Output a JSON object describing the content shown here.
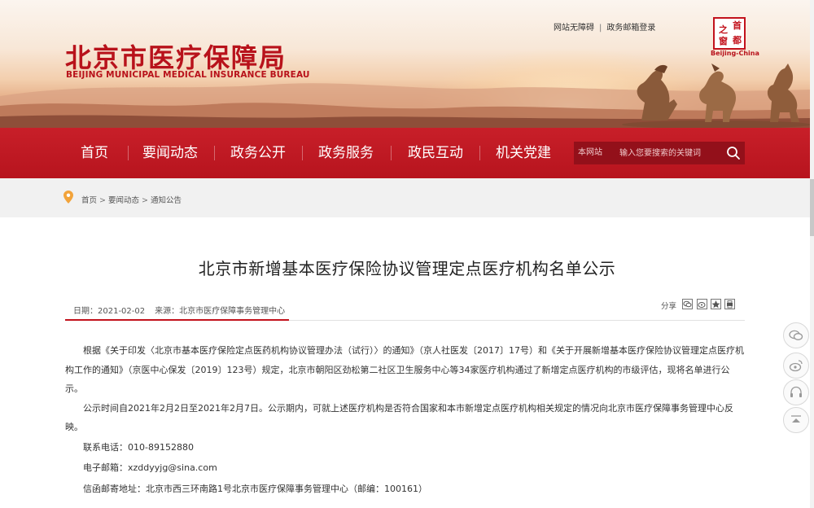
{
  "header": {
    "title_cn": "北京市医疗保障局",
    "title_en": "BEIJING MUNICIPAL MEDICAL INSURANCE BUREAU",
    "top_links": [
      "网站无障碍",
      "政务邮箱登录"
    ],
    "top_links_separator": "|",
    "seal_chars": [
      "首",
      "都",
      "之",
      "窗"
    ],
    "seal_caption": "Beijing-China",
    "brand_color": "#b8121b"
  },
  "nav": {
    "items": [
      "首页",
      "要闻动态",
      "政务公开",
      "政务服务",
      "政民互动",
      "机关党建"
    ],
    "search_scope": "本网站",
    "search_placeholder": "输入您要搜索的关键词",
    "bar_color": "#c81f29"
  },
  "breadcrumb": {
    "items": [
      "首页",
      "要闻动态",
      "通知公告"
    ],
    "separator": ">"
  },
  "article": {
    "title": "北京市新增基本医疗保险协议管理定点医疗机构名单公示",
    "date": "日期：2021-02-02",
    "source": "来源：北京市医疗保障事务管理中心",
    "share_label": "分享",
    "share_icons": [
      "wechat-icon",
      "weibo-icon",
      "qzone-icon",
      "print-icon"
    ],
    "paragraphs": [
      "根据《关于印发〈北京市基本医疗保险定点医药机构协议管理办法（试行）〉的通知》（京人社医发〔2017〕17号）和《关于开展新增基本医疗保险协议管理定点医疗机构工作的通知》（京医中心保发〔2019〕123号）规定，北京市朝阳区劲松第二社区卫生服务中心等34家医疗机构通过了新增定点医疗机构的市级评估，现将名单进行公示。",
      "公示时间自2021年2月2日至2021年2月7日。公示期内，可就上述医疗机构是否符合国家和本市新增定点医疗机构相关规定的情况向北京市医疗保障事务管理中心反映。"
    ],
    "contacts": [
      "联系电话：010-89152880",
      "电子邮箱：xzddyyjg@sina.com",
      "信函邮寄地址：北京市西三环南路1号北京市医疗保障事务管理中心（邮编：100161）"
    ]
  },
  "float_tools": [
    "wechat-icon",
    "weibo-icon",
    "headset-icon",
    "back-to-top-icon"
  ]
}
